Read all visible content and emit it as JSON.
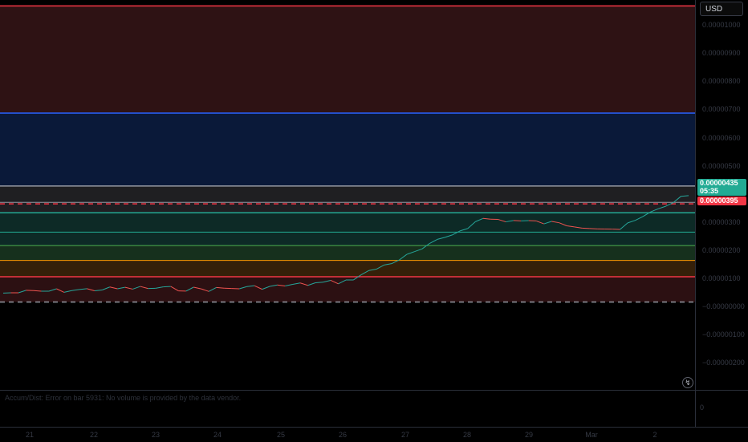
{
  "theme": {
    "zone_colors": {
      "top_red": "#2e1214",
      "blue": "#0a1939",
      "gray": "#1f1f22",
      "teal": "#0d2a26",
      "green": "#16301d",
      "orange": "#352009",
      "bottom_red": "#2c1012"
    },
    "line_colors": {
      "red": "#f23645",
      "blue": "#2962ff",
      "gray": "#9598a1",
      "teal": "#22ab94",
      "green": "#4caf50",
      "orange": "#ff9800",
      "candle_up": "#26a69a",
      "candle_down": "#ef5350"
    }
  },
  "header": {
    "legend_text": ""
  },
  "price_axis": {
    "currency_button": "USD",
    "labels": [
      "0.00001000",
      "0.00000900",
      "0.00000800",
      "0.00000700",
      "0.00000600",
      "0.00000500",
      "0.00000300",
      "0.00000200",
      "0.00000100",
      "−0.00000000",
      "−0.00000100",
      "−0.00000200"
    ],
    "current_price": "0.00000435",
    "countdown": "05:35",
    "marked_price": "0.00000395"
  },
  "indicator_pane": {
    "message": "Accum/Dist: Error on bar 5931: No volume is provided by the data vendor.",
    "axis_value": "0"
  },
  "time_axis": {
    "labels": [
      "21",
      "22",
      "23",
      "24",
      "25",
      "26",
      "27",
      "28",
      "29",
      "Mar",
      "2"
    ]
  },
  "chart_data": {
    "type": "line",
    "x": [
      "21",
      "22",
      "23",
      "24",
      "25",
      "26",
      "27",
      "28",
      "29",
      "Mar",
      "2"
    ],
    "series": [
      {
        "values": [
          9.5e-07,
          1.05e-06,
          1.12e-06,
          1.08e-06,
          1.18e-06,
          1.35e-06,
          2.3e-06,
          3.45e-06,
          3.3e-06,
          3.1e-06,
          4.3e-06
        ]
      }
    ],
    "current_price": 4.35e-06,
    "ylim": [
      -2.3e-06,
      1.08e-05
    ],
    "horizontal_levels": [
      1.06e-05,
      7e-06,
      4.55e-06,
      4e-06,
      3.95e-06,
      3.65e-06,
      3e-06,
      2.55e-06,
      2.05e-06,
      1.5e-06,
      6.5e-07
    ],
    "zones": [
      {
        "from": 7e-06,
        "to": 1.06e-05,
        "color": "top_red"
      },
      {
        "from": 4.55e-06,
        "to": 7e-06,
        "color": "blue"
      },
      {
        "from": 3.65e-06,
        "to": 4.55e-06,
        "color": "gray"
      },
      {
        "from": 3e-06,
        "to": 3.65e-06,
        "color": "teal"
      },
      {
        "from": 2.55e-06,
        "to": 3e-06,
        "color": "teal"
      },
      {
        "from": 2.05e-06,
        "to": 2.55e-06,
        "color": "green"
      },
      {
        "from": 1.5e-06,
        "to": 2.05e-06,
        "color": "orange"
      },
      {
        "from": 6.5e-07,
        "to": 1.5e-06,
        "color": "bottom_red"
      }
    ]
  }
}
